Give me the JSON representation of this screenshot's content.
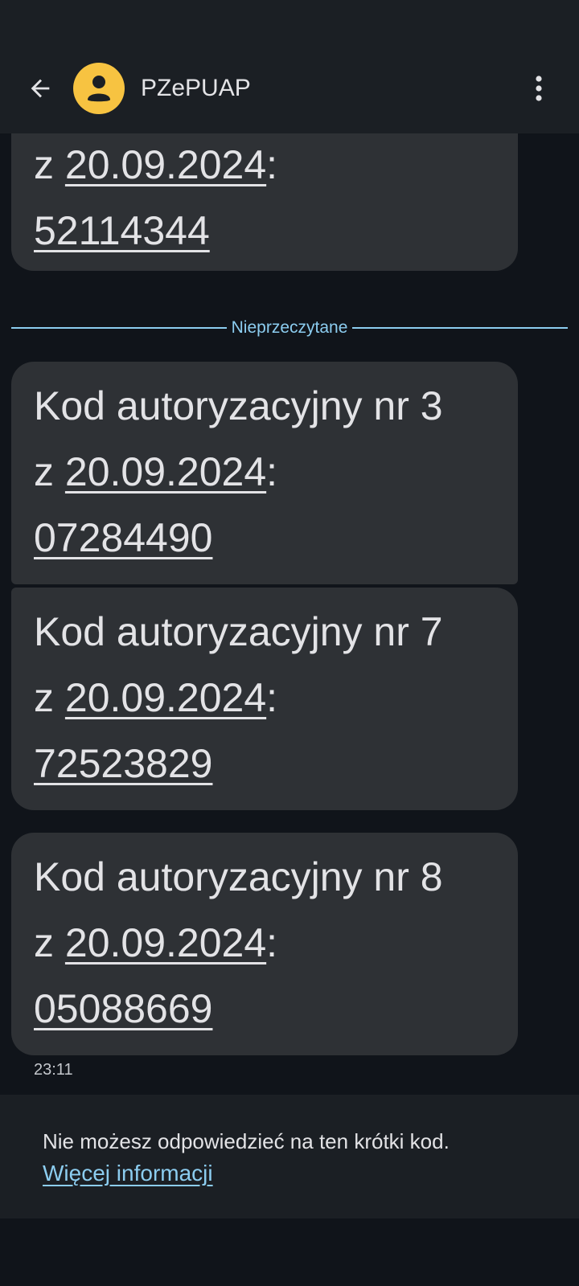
{
  "header": {
    "contact_name": "PZePUAP",
    "back_icon": "arrow-back-icon",
    "avatar_icon": "person-icon",
    "more_icon": "more-vert-icon",
    "avatar_color": "#f7c341"
  },
  "messages": [
    {
      "line2_prefix": "z ",
      "date": "20.09.2024",
      "line2_suffix": ":",
      "code": "52114344"
    },
    {
      "line1": "Kod autoryzacyjny nr 3",
      "line2_prefix": "z ",
      "date": "20.09.2024",
      "line2_suffix": ":",
      "code": "07284490"
    },
    {
      "line1": "Kod autoryzacyjny nr 7",
      "line2_prefix": "z ",
      "date": "20.09.2024",
      "line2_suffix": ":",
      "code": "72523829"
    },
    {
      "line1": "Kod autoryzacyjny nr 8",
      "line2_prefix": "z ",
      "date": "20.09.2024",
      "line2_suffix": ":",
      "code": "05088669"
    }
  ],
  "divider_label": "Nieprzeczytane",
  "timestamp": "23:11",
  "reply_notice": {
    "text": "Nie możesz odpowiedzieć na ten krótki kod.",
    "link": "Więcej informacji"
  },
  "colors": {
    "background": "#10141a",
    "bar": "#1b1f24",
    "bubble": "#2e3135",
    "accent": "#8ccdf0"
  }
}
